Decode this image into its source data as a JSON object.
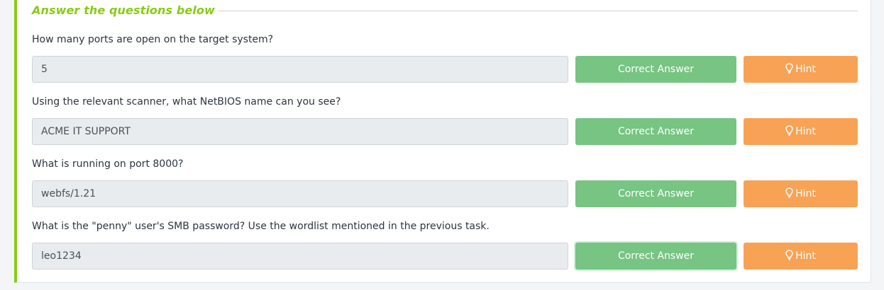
{
  "section": {
    "title": "Answer the questions below"
  },
  "questions": [
    {
      "text": "How many ports are open on the target system?",
      "answer": "5",
      "correct_label": "Correct Answer",
      "hint_label": "Hint"
    },
    {
      "text": "Using the relevant scanner, what NetBIOS name can you see?",
      "answer": "ACME IT SUPPORT",
      "correct_label": "Correct Answer",
      "hint_label": "Hint"
    },
    {
      "text": "What is running on port 8000?",
      "answer": "webfs/1.21",
      "correct_label": "Correct Answer",
      "hint_label": "Hint"
    },
    {
      "text": "What is the \"penny\" user's SMB password? Use the wordlist mentioned in the previous task.",
      "answer": "leo1234",
      "correct_label": "Correct Answer",
      "hint_label": "Hint"
    }
  ],
  "icons": {
    "hint": "lightbulb-icon"
  },
  "colors": {
    "accent": "#88cc14",
    "correct_button": "#77c483",
    "hint_button": "#f8a256",
    "input_bg": "#e9ecef"
  }
}
